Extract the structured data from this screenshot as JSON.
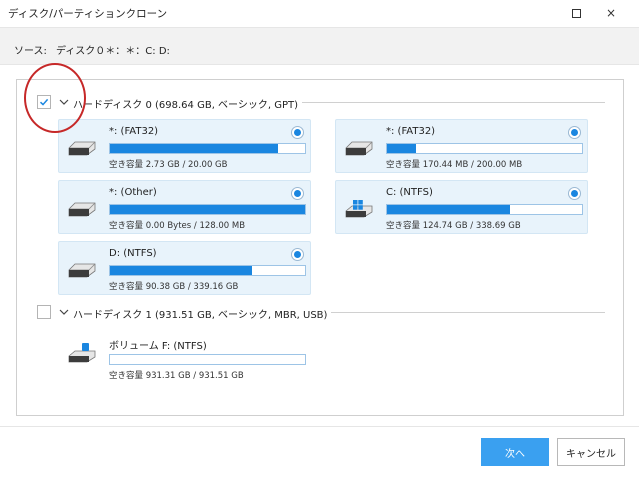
{
  "window": {
    "title": "ディスク/パーティションクローン",
    "maximize_icon": "maximize-icon",
    "close_icon": "close-icon",
    "close_glyph": "×"
  },
  "source": {
    "label": "ソース:",
    "value": "ディスク０＊：＊：C: D:"
  },
  "disks": [
    {
      "checked": true,
      "label": "ハードディスク 0 (698.64 GB, ベーシック, GPT)",
      "partitions": [
        {
          "name": "*: (FAT32)",
          "space": "空き容量 2.73 GB / 20.00 GB",
          "used_fraction": 0.86,
          "selected": true,
          "icon": "drive-icon"
        },
        {
          "name": "*: (FAT32)",
          "space": "空き容量 170.44 MB / 200.00 MB",
          "used_fraction": 0.15,
          "selected": true,
          "icon": "drive-icon"
        },
        {
          "name": "*: (Other)",
          "space": "空き容量 0.00 Bytes / 128.00 MB",
          "used_fraction": 1.0,
          "selected": true,
          "icon": "drive-icon"
        },
        {
          "name": "C: (NTFS)",
          "space": "空き容量 124.74 GB / 338.69 GB",
          "used_fraction": 0.63,
          "selected": true,
          "icon": "windows-drive-icon"
        },
        {
          "name": "D: (NTFS)",
          "space": "空き容量 90.38 GB / 339.16 GB",
          "used_fraction": 0.73,
          "selected": true,
          "icon": "drive-icon"
        }
      ]
    },
    {
      "checked": false,
      "label": "ハードディスク 1 (931.51 GB, ベーシック, MBR, USB)",
      "partitions": [
        {
          "name": "ボリューム F: (NTFS)",
          "space": "空き容量 931.31 GB / 931.51 GB",
          "used_fraction": 0.0,
          "selected": false,
          "icon": "usb-drive-icon"
        }
      ]
    }
  ],
  "buttons": {
    "next": "次へ",
    "cancel": "キャンセル"
  },
  "colors": {
    "accent": "#1a86e0",
    "next_button": "#3aa0f0",
    "annotation_circle": "#c62828",
    "card_background": "#e8f3fb"
  }
}
